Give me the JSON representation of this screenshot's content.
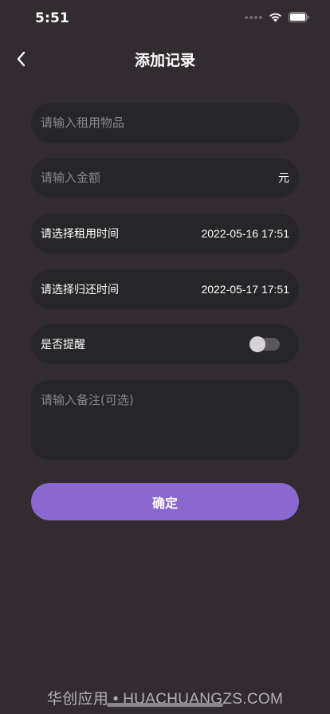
{
  "status_bar": {
    "time": "5:51"
  },
  "header": {
    "title": "添加记录",
    "back_icon": "chevron-left-icon"
  },
  "form": {
    "item_placeholder": "请输入租用物品",
    "amount_placeholder": "请输入金额",
    "amount_unit": "元",
    "rent_time_label": "请选择租用时间",
    "rent_time_value": "2022-05-16 17:51",
    "return_time_label": "请选择归还时间",
    "return_time_value": "2022-05-17 17:51",
    "remind_label": "是否提醒",
    "remind_enabled": false,
    "notes_placeholder": "请输入备注(可选)"
  },
  "confirm_label": "确定",
  "watermark": "华创应用 • HUACHUANGZS.COM",
  "colors": {
    "background": "#322c30",
    "field_background": "#262527",
    "accent": "#8a68cf"
  }
}
